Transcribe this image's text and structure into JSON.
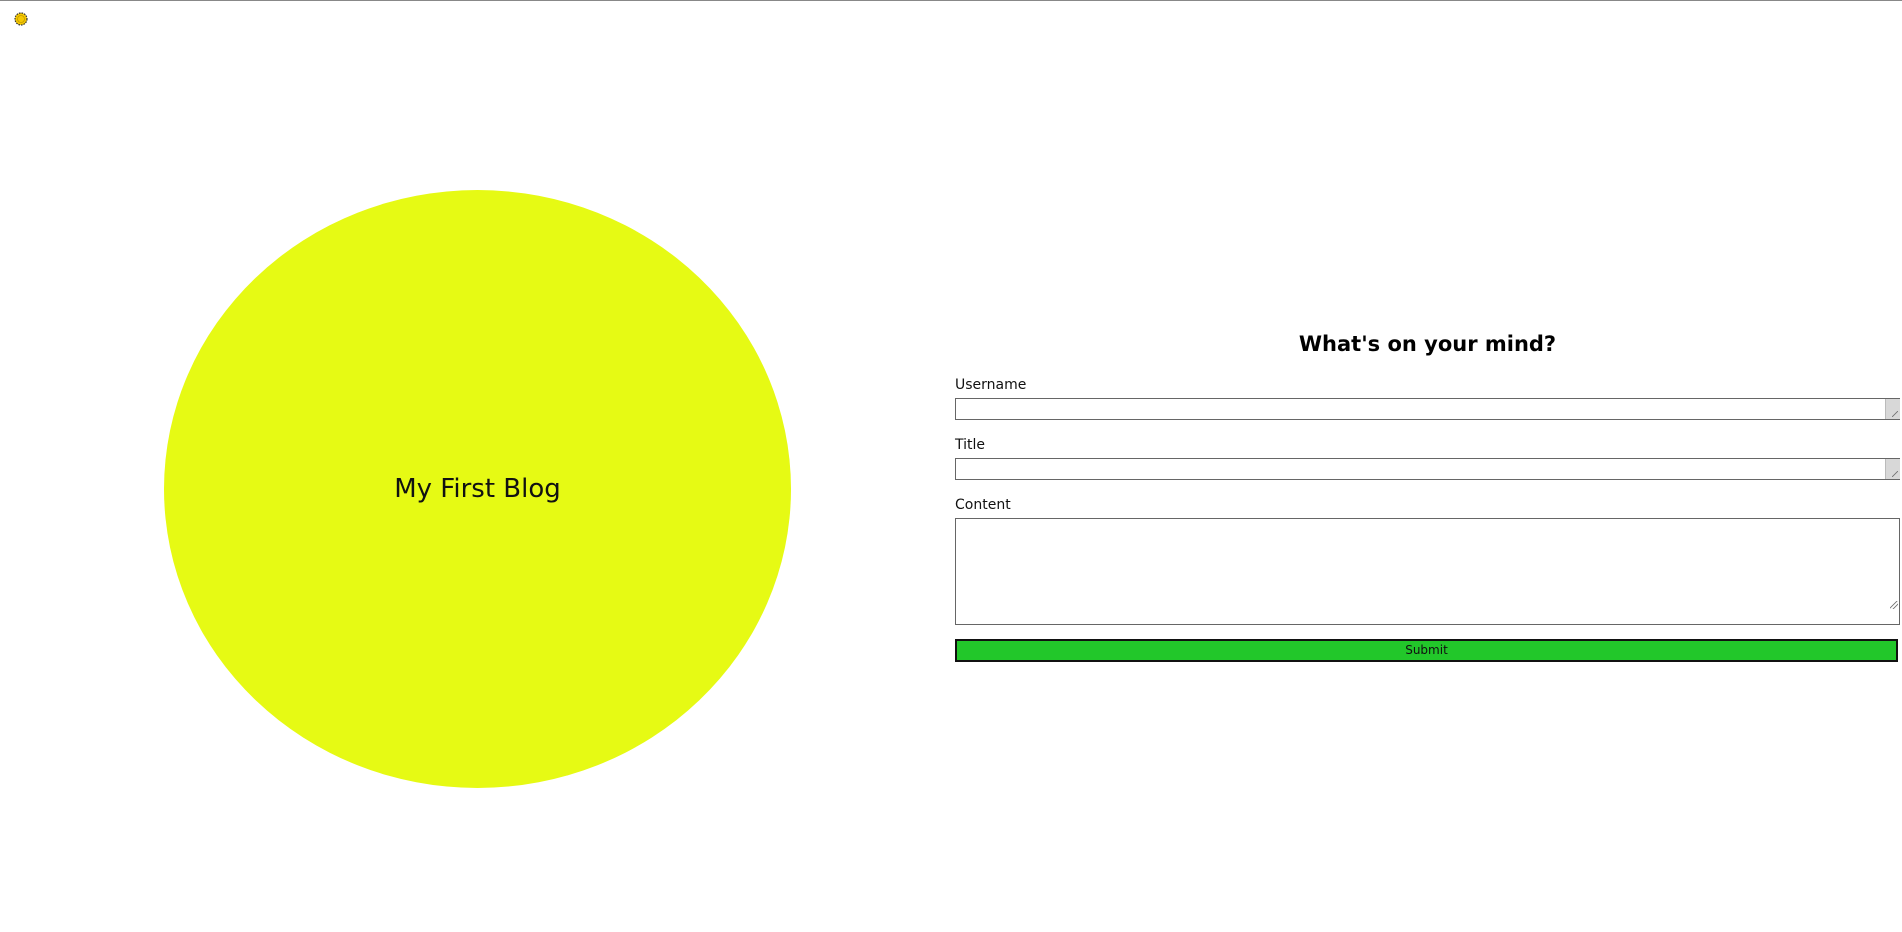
{
  "colors": {
    "circle_fill": "#e6fa14",
    "submit_fill": "#22c72a",
    "corner_icon_fill": "#f5c800"
  },
  "corner_icon": {
    "name": "sun-icon"
  },
  "hero": {
    "title": "My First Blog"
  },
  "form": {
    "heading": "What's on your mind?",
    "username_label": "Username",
    "username_value": "",
    "title_label": "Title",
    "title_value": "",
    "content_label": "Content",
    "content_value": "",
    "submit_label": "Submit"
  }
}
